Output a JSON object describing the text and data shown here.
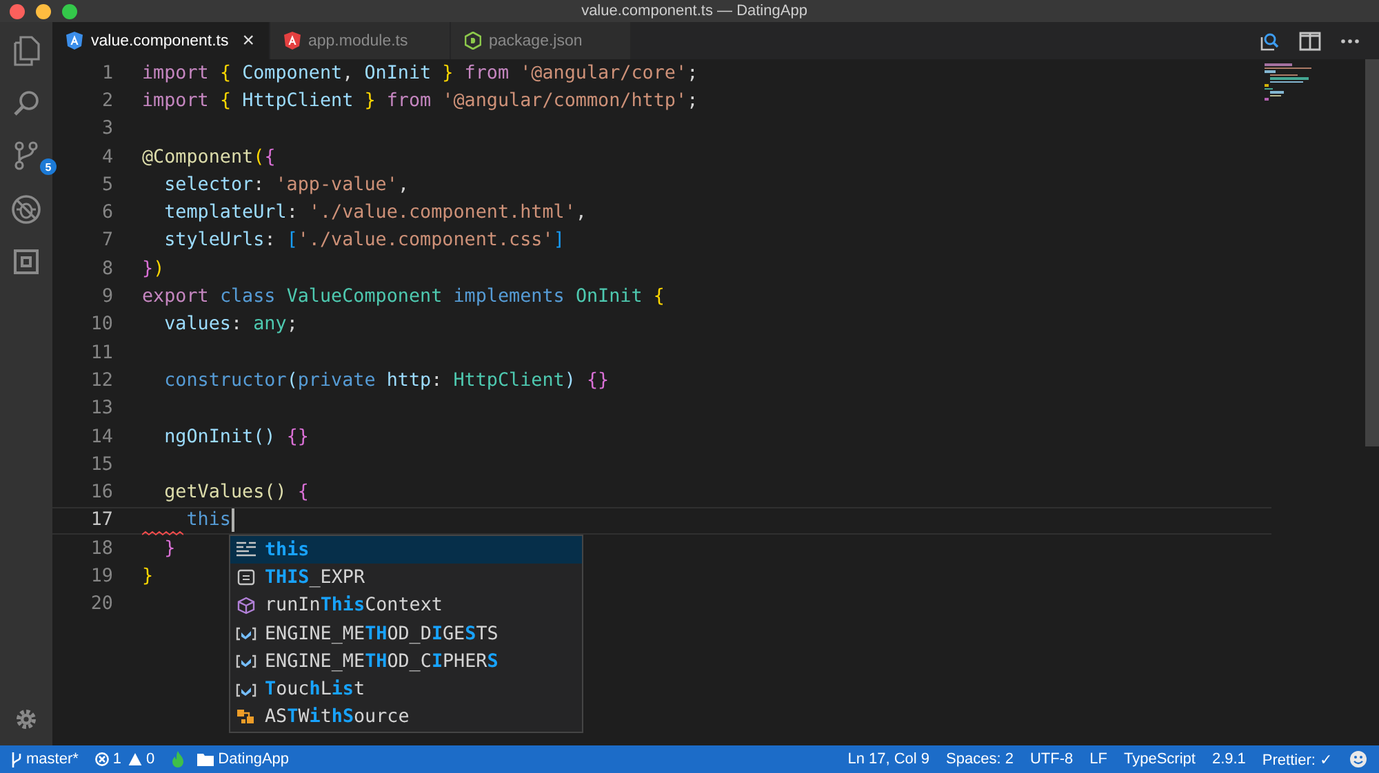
{
  "window": {
    "title": "value.component.ts — DatingApp"
  },
  "activity_bar": [
    {
      "kind": "files"
    },
    {
      "kind": "search"
    },
    {
      "kind": "scm",
      "badge": "5"
    },
    {
      "kind": "debug"
    },
    {
      "kind": "extensions"
    }
  ],
  "settings": {
    "kind": "gear"
  },
  "tabs": [
    {
      "label": "value.component.ts",
      "selected": true,
      "kind": "angular",
      "color": "#3b8eea",
      "close": "×"
    },
    {
      "label": "app.module.ts",
      "selected": false,
      "kind": "angular",
      "color": "#e44040"
    },
    {
      "label": "package.json",
      "selected": false,
      "kind": "node",
      "color": "#8cc84b"
    }
  ],
  "editor": {
    "lines": [
      {
        "number": "1",
        "current": false,
        "tokens": [
          {
            "kind": "kw",
            "text": "import "
          },
          {
            "kind": "b1",
            "text": "{ "
          },
          {
            "kind": "var",
            "text": "Component"
          },
          {
            "kind": "plain",
            "text": ", "
          },
          {
            "kind": "var",
            "text": "OnInit"
          },
          {
            "kind": "b1",
            "text": " }"
          },
          {
            "kind": "kw",
            "text": " from "
          },
          {
            "kind": "str",
            "text": "'@angular/core'"
          },
          {
            "kind": "plain",
            "text": ";"
          }
        ]
      },
      {
        "number": "2",
        "current": false,
        "tokens": [
          {
            "kind": "kw",
            "text": "import "
          },
          {
            "kind": "b1",
            "text": "{ "
          },
          {
            "kind": "var",
            "text": "HttpClient"
          },
          {
            "kind": "b1",
            "text": " }"
          },
          {
            "kind": "kw",
            "text": " from "
          },
          {
            "kind": "str",
            "text": "'@angular/common/http'"
          },
          {
            "kind": "plain",
            "text": ";"
          }
        ]
      },
      {
        "number": "3",
        "current": false
      },
      {
        "number": "4",
        "current": false,
        "tokens": [
          {
            "kind": "fn",
            "text": "@Component"
          },
          {
            "kind": "b1",
            "text": "("
          },
          {
            "kind": "b2",
            "text": "{"
          }
        ]
      },
      {
        "number": "5",
        "current": false,
        "tokens": [
          {
            "kind": "var",
            "text": "  selector"
          },
          {
            "kind": "plain",
            "text": ": "
          },
          {
            "kind": "str",
            "text": "'app-value'"
          },
          {
            "kind": "plain",
            "text": ","
          }
        ]
      },
      {
        "number": "6",
        "current": false,
        "tokens": [
          {
            "kind": "var",
            "text": "  templateUrl"
          },
          {
            "kind": "plain",
            "text": ": "
          },
          {
            "kind": "str",
            "text": "'./value.component.html'"
          },
          {
            "kind": "plain",
            "text": ","
          }
        ]
      },
      {
        "number": "7",
        "current": false,
        "tokens": [
          {
            "kind": "var",
            "text": "  styleUrls"
          },
          {
            "kind": "plain",
            "text": ": "
          },
          {
            "kind": "b3",
            "text": "["
          },
          {
            "kind": "str",
            "text": "'./value.component.css'"
          },
          {
            "kind": "b3",
            "text": "]"
          }
        ]
      },
      {
        "number": "8",
        "current": false,
        "tokens": [
          {
            "kind": "b2",
            "text": "}"
          },
          {
            "kind": "b1",
            "text": ")"
          }
        ]
      },
      {
        "number": "9",
        "current": false,
        "tokens": [
          {
            "kind": "kw",
            "text": "export "
          },
          {
            "kind": "storage",
            "text": "class "
          },
          {
            "kind": "type",
            "text": "ValueComponent "
          },
          {
            "kind": "storage",
            "text": "implements "
          },
          {
            "kind": "type",
            "text": "OnInit "
          },
          {
            "kind": "b1",
            "text": "{"
          }
        ]
      },
      {
        "number": "10",
        "current": false,
        "tokens": [
          {
            "kind": "var",
            "text": "  values"
          },
          {
            "kind": "plain",
            "text": ": "
          },
          {
            "kind": "type",
            "text": "any"
          },
          {
            "kind": "plain",
            "text": ";"
          }
        ]
      },
      {
        "number": "11",
        "current": false
      },
      {
        "number": "12",
        "current": false,
        "tokens": [
          {
            "kind": "storage",
            "text": "  constructor"
          },
          {
            "kind": "var",
            "text": "("
          },
          {
            "kind": "storage",
            "text": "private "
          },
          {
            "kind": "var",
            "text": "http"
          },
          {
            "kind": "plain",
            "text": ": "
          },
          {
            "kind": "type",
            "text": "HttpClient"
          },
          {
            "kind": "var",
            "text": ") "
          },
          {
            "kind": "b2",
            "text": "{}"
          }
        ]
      },
      {
        "number": "13",
        "current": false
      },
      {
        "number": "14",
        "current": false,
        "tokens": [
          {
            "kind": "var",
            "text": "  ngOnInit() "
          },
          {
            "kind": "b2",
            "text": "{}"
          }
        ]
      },
      {
        "number": "15",
        "current": false
      },
      {
        "number": "16",
        "current": false,
        "tokens": [
          {
            "kind": "fn",
            "text": "  getValues() "
          },
          {
            "kind": "b2",
            "text": "{"
          }
        ]
      },
      {
        "number": "17",
        "current": true,
        "tokens": [
          {
            "kind": "storage",
            "text": "    this"
          }
        ]
      },
      {
        "number": "18",
        "current": false,
        "tokens": [
          {
            "kind": "b2",
            "text": "  }"
          }
        ]
      },
      {
        "number": "19",
        "current": false,
        "tokens": [
          {
            "kind": "b1",
            "text": "}"
          }
        ]
      },
      {
        "number": "20",
        "current": false
      }
    ],
    "suggestions": [
      {
        "kind": "snippet",
        "selected": true,
        "parts": [
          {
            "text": "this",
            "match": true
          }
        ]
      },
      {
        "kind": "constant",
        "selected": false,
        "parts": [
          {
            "text": "THIS",
            "match": true
          },
          {
            "text": "_EXPR",
            "match": false
          }
        ]
      },
      {
        "kind": "method",
        "selected": false,
        "parts": [
          {
            "text": "runIn",
            "match": false
          },
          {
            "text": "This",
            "match": true
          },
          {
            "text": "Context",
            "match": false
          }
        ]
      },
      {
        "kind": "variable",
        "selected": false,
        "parts": [
          {
            "text": "ENGINE_ME",
            "match": false
          },
          {
            "text": "TH",
            "match": true
          },
          {
            "text": "OD_D",
            "match": false
          },
          {
            "text": "I",
            "match": true
          },
          {
            "text": "GE",
            "match": false
          },
          {
            "text": "S",
            "match": true
          },
          {
            "text": "TS",
            "match": false
          }
        ]
      },
      {
        "kind": "variable",
        "selected": false,
        "parts": [
          {
            "text": "ENGINE_ME",
            "match": false
          },
          {
            "text": "TH",
            "match": true
          },
          {
            "text": "OD_C",
            "match": false
          },
          {
            "text": "I",
            "match": true
          },
          {
            "text": "PHER",
            "match": false
          },
          {
            "text": "S",
            "match": true
          }
        ]
      },
      {
        "kind": "variable",
        "selected": false,
        "parts": [
          {
            "text": "T",
            "match": true
          },
          {
            "text": "ouc",
            "match": false
          },
          {
            "text": "h",
            "match": true
          },
          {
            "text": "L",
            "match": false
          },
          {
            "text": "is",
            "match": true
          },
          {
            "text": "t",
            "match": false
          }
        ]
      },
      {
        "kind": "class",
        "selected": false,
        "parts": [
          {
            "text": "AS",
            "match": false
          },
          {
            "text": "T",
            "match": true
          },
          {
            "text": "W",
            "match": false
          },
          {
            "text": "i",
            "match": true
          },
          {
            "text": "t",
            "match": false
          },
          {
            "text": "h",
            "match": true
          },
          {
            "text": "S",
            "match": true
          },
          {
            "text": "ource",
            "match": false
          }
        ]
      }
    ]
  },
  "status_bar": {
    "left": [
      {
        "kind": "branch",
        "text": "master*"
      },
      {
        "kind": "errors",
        "text": "1"
      },
      {
        "kind": "warnings",
        "text": "0"
      },
      {
        "kind": "flame"
      },
      {
        "kind": "folder",
        "text": "DatingApp"
      }
    ],
    "right": [
      {
        "kind": "text",
        "text": "Ln 17, Col 9"
      },
      {
        "kind": "text",
        "text": "Spaces: 2"
      },
      {
        "kind": "text",
        "text": "UTF-8"
      },
      {
        "kind": "text",
        "text": "LF"
      },
      {
        "kind": "text",
        "text": "TypeScript"
      },
      {
        "kind": "text",
        "text": "2.9.1"
      },
      {
        "kind": "text",
        "text": "Prettier: ✓"
      },
      {
        "kind": "feedback"
      }
    ]
  }
}
